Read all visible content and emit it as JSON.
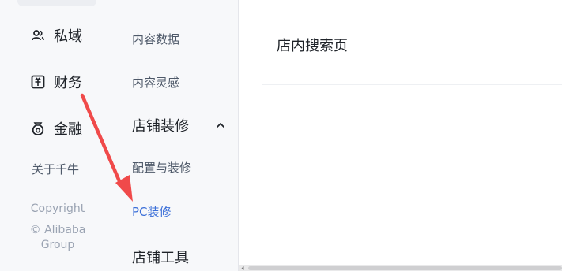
{
  "left_rail": {
    "items": [
      {
        "label": "私域",
        "icon": "users-icon"
      },
      {
        "label": "财务",
        "icon": "finance-icon"
      },
      {
        "label": "金融",
        "icon": "money-bag-icon"
      }
    ],
    "about_link": "关于千牛",
    "copyright": [
      "Copyright",
      "© Alibaba",
      "Group"
    ]
  },
  "sub_menu": {
    "items_top": [
      "内容数据",
      "内容灵感"
    ],
    "group_store_decoration": {
      "label": "店铺装修",
      "expanded": true,
      "items": [
        "配置与装修",
        "PC装修"
      ],
      "active_item": "PC装修"
    },
    "group_store_tools": {
      "label": "店铺工具"
    }
  },
  "content": {
    "page_row_label": "店内搜索页"
  },
  "colors": {
    "accent_blue": "#3b6fd8",
    "annotation_red": "#f04a4a",
    "rail_bg": "#f7f8fa"
  }
}
